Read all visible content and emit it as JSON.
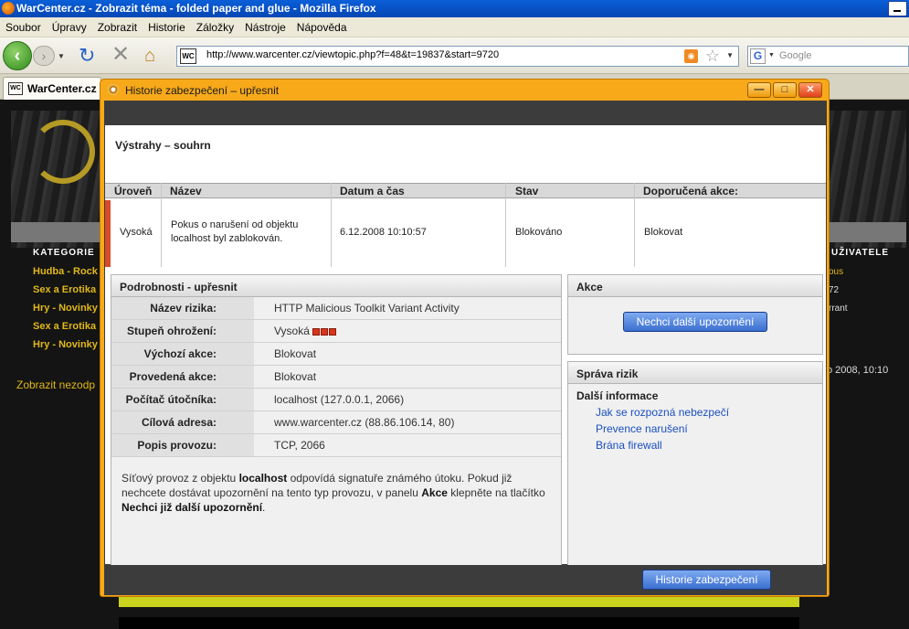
{
  "browser": {
    "window_title": "WarCenter.cz - Zobrazit téma - folded paper and glue - Mozilla Firefox",
    "menu": [
      "Soubor",
      "Úpravy",
      "Zobrazit",
      "Historie",
      "Záložky",
      "Nástroje",
      "Nápověda"
    ],
    "url": "http://www.warcenter.cz/viewtopic.php?f=48&t=19837&start=9720",
    "site_icon_text": "WC",
    "search_placeholder": "Google",
    "search_engine_icon": "G",
    "tab_title": "WarCenter.cz"
  },
  "webpage": {
    "categories_title": "KATEGORIE",
    "categories": [
      "Hudba - Rock",
      "Sex a Erotika",
      "Hry - Novinky",
      "Sex a Erotika",
      "Hry - Novinky"
    ],
    "show_link": "Zobrazit nezodp",
    "users_title": "UŽIVATELE",
    "users": [
      {
        "text": "ous",
        "color": "#e0b818"
      },
      {
        "text": "72",
        "color": "#dddddd"
      },
      {
        "text": "rrant",
        "color": "#dddddd"
      }
    ],
    "date_right": "o 2008, 10:10"
  },
  "dialog": {
    "title": "Historie zabezpečení – upřesnit",
    "summary_heading": "Výstrahy – souhrn",
    "columns": [
      "Úroveň",
      "Název",
      "Datum a čas",
      "Stav",
      "Doporučená akce:"
    ],
    "alert": {
      "level": "Vysoká",
      "name": "Pokus o narušení od objektu localhost byl zablokován.",
      "datetime": "6.12.2008 10:10:57",
      "status": "Blokováno",
      "recommended_action": "Blokovat",
      "severity_color": "#d84a2a"
    },
    "details": {
      "heading": "Podrobnosti - upřesnit",
      "rows": [
        {
          "label": "Název rizika:",
          "value": "HTTP Malicious Toolkit Variant Activity"
        },
        {
          "label": "Stupeň ohrožení:",
          "value": "Vysoká"
        },
        {
          "label": "Výchozí akce:",
          "value": "Blokovat"
        },
        {
          "label": "Provedená akce:",
          "value": "Blokovat"
        },
        {
          "label": "Počítač útočníka:",
          "value": "localhost (127.0.0.1, 2066)"
        },
        {
          "label": "Cílová adresa:",
          "value": "www.warcenter.cz (88.86.106.14, 80)"
        },
        {
          "label": "Popis provozu:",
          "value": "TCP, 2066"
        }
      ],
      "description": {
        "p1": "Síťový provoz z objektu ",
        "b1": "localhost",
        "p2": " odpovídá signatuře známého útoku. Pokud již nechcete dostávat upozornění na tento typ provozu, v panelu ",
        "b2": "Akce",
        "p3": " klepněte na tlačítko ",
        "b3": "Nechci již další upozornění",
        "p4": "."
      }
    },
    "actions": {
      "heading": "Akce",
      "button": "Nechci další upozornění"
    },
    "risk": {
      "heading": "Správa rizik",
      "subheading": "Další informace",
      "links": [
        "Jak se rozpozná nebezpečí",
        "Prevence narušení",
        "Brána firewall"
      ]
    },
    "footer_button": "Historie zabezpečení"
  },
  "colors": {
    "dialog_frame": "#f7a91a",
    "dialog_dark": "#3c3c3c",
    "link_blue": "#1a4fbf",
    "accent_yellow": "#e0b818"
  }
}
